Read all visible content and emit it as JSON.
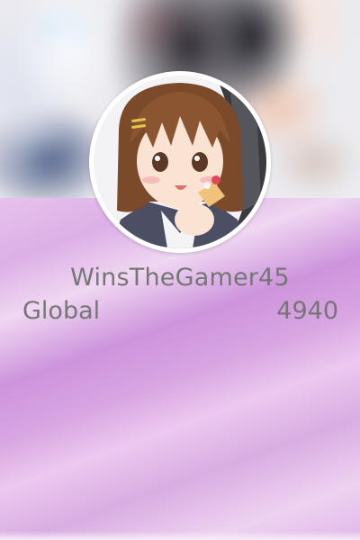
{
  "profile": {
    "username": "WinsTheGamer45",
    "region_label": "Global",
    "score": "4940"
  },
  "colors": {
    "text": "#767676",
    "gradient_purple": "#d9a6e2",
    "avatar_border": "#ffffff"
  }
}
